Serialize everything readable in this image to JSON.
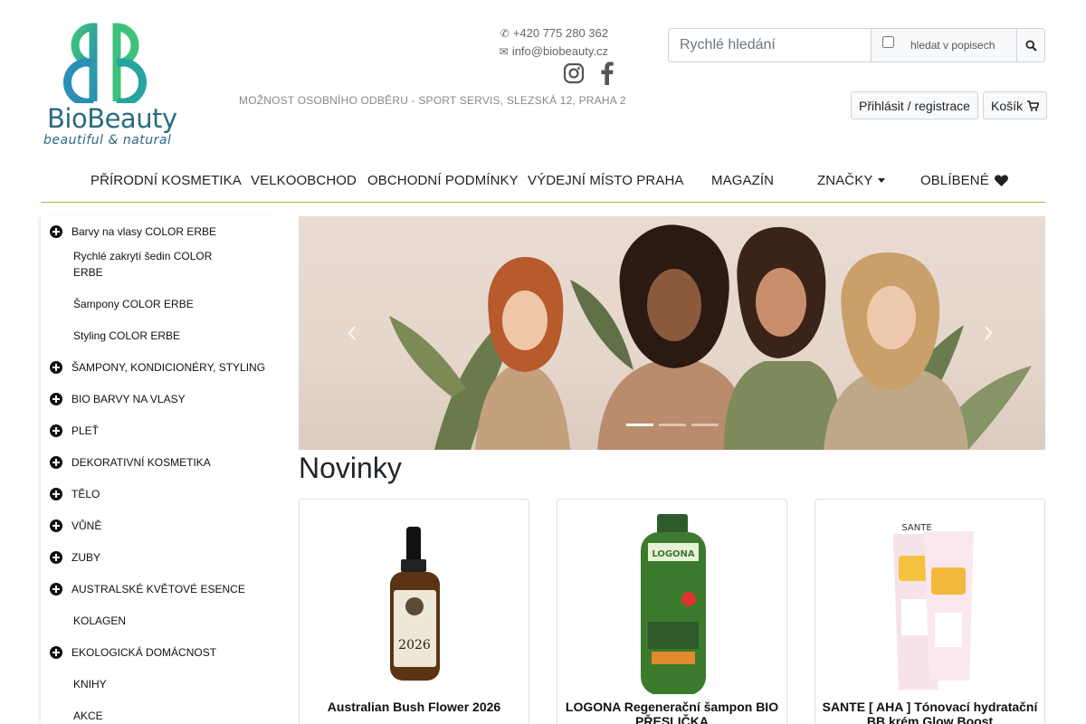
{
  "brand": {
    "name": "BioBeauty",
    "tagline": "beautiful & natural"
  },
  "contact": {
    "phone": "+420 775 280 362",
    "email": "info@biobeauty.cz",
    "pickup": "MOŽNOST OSOBNÍHO ODBĚRU - SPORT SERVIS, SLEZSKÁ 12, PRAHA 2"
  },
  "search": {
    "placeholder": "Rychlé hledání",
    "value": "",
    "option_label": "hledat v popisech",
    "option_checked": false
  },
  "account": {
    "login_label": "Přihlásit / registrace",
    "cart_label": "Košík"
  },
  "nav": {
    "items": [
      "PŘÍRODNÍ KOSMETIKA",
      "VELKOOBCHOD",
      "OBCHODNÍ PODMÍNKY",
      "VÝDEJNÍ MÍSTO PRAHA",
      "MAGAZÍN",
      "ZNAČKY",
      "OBLÍBENÉ"
    ]
  },
  "sidebar": {
    "items": [
      "Barvy na vlasy COLOR ERBE",
      "Rychlé zakrytí šedin COLOR ERBE",
      "Šampony COLOR ERBE",
      "Styling COLOR ERBE",
      "ŠAMPONY, KONDICIONÉRY, STYLING",
      "BIO BARVY NA VLASY",
      "PLEŤ",
      "DEKORATIVNÍ KOSMETIKA",
      "TĚLO",
      "VŮNĚ",
      "ZUBY",
      "AUSTRALSKÉ KVĚTOVÉ ESENCE",
      "KOLAGEN",
      "EKOLOGICKÁ DOMÁCNOST",
      "KNIHY",
      "AKCE"
    ]
  },
  "carousel": {
    "prev_label": "Previous",
    "next_label": "Next",
    "slide_count": 3,
    "active_index": 0
  },
  "products": {
    "title": "Novinky",
    "items": [
      {
        "name": "Australian Bush Flower 2026",
        "label": "2026"
      },
      {
        "name": "LOGONA Regenerační šampon BIO PŘESLIČKA",
        "label": "LOGONA"
      },
      {
        "name": "SANTE [ AHA ] Tónovací hydratační BB krém Glow Boost",
        "label": "SANTE"
      }
    ]
  },
  "colors": {
    "nav_underline": "#8bc34a",
    "logo_green": "#3fbf7f",
    "logo_teal": "#2a8fb5"
  }
}
